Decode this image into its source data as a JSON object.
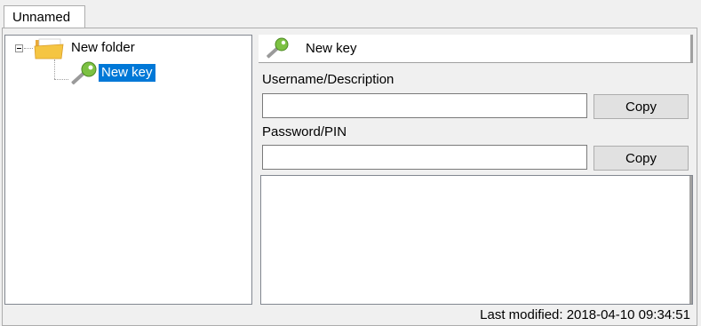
{
  "tab": {
    "label": "Unnamed"
  },
  "tree": {
    "folder_label": "New folder",
    "key_label": "New key"
  },
  "detail": {
    "title": "New key",
    "username_label": "Username/Description",
    "username_value": "",
    "password_label": "Password/PIN",
    "password_value": "",
    "copy_label": "Copy",
    "notes_value": ""
  },
  "status": {
    "last_modified": "Last modified: 2018-04-10 09:34:51"
  },
  "colors": {
    "selection": "#0078d7",
    "key_green": "#7cc142",
    "folder_yellow": "#f5c542"
  }
}
